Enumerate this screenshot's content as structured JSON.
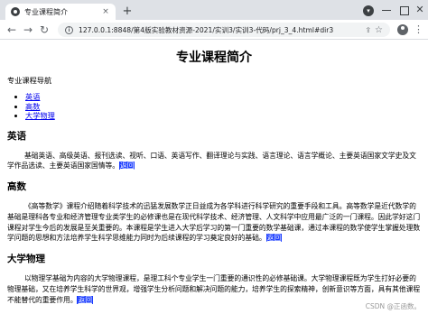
{
  "browser": {
    "tab_title": "专业课程简介",
    "tab_close": "×",
    "new_tab": "+",
    "url": "127.0.0.1:8848/第4版实验教材资源-2021/实训3/实训3-代码/prj_3_4.html#dir3",
    "back": "←",
    "forward": "→",
    "reload": "↻",
    "menu": "⋮"
  },
  "page": {
    "title": "专业课程简介",
    "nav_heading": "专业课程导航",
    "nav_items": [
      "英语",
      "高数",
      "大学物理"
    ],
    "back_link": "返回",
    "sections": [
      {
        "heading": "英语",
        "body": "基础英语、高级英语、报刊选读、视听、口语、英语写作、翻译理论与实践、语言理论、语言学概论、主要英语国家文学史及文学作品选读、主要英语国家国情等。"
      },
      {
        "heading": "高数",
        "body": "《高等数学》课程介绍随着科学技术的迅猛发展数学正日益成为各学科进行科学研究的重要手段和工具。高等数学是近代数学的基础是理科各专业和经济管理专业类学生的必修课也是在现代科学技术、经济管理、人文科学中应用最广泛的一门课程。因此学好这门课程对学生今后的发展是至关重要的。本课程是学生进入大学后学习的第一门重要的数学基础课，通过本课程的数学使学生掌握处理数学问题的思想和方法培养学生科学思维能力同时为后续课程的学习奠定良好的基础。"
      },
      {
        "heading": "大学物理",
        "body": "以物理学基础为内容的大学物理课程，是理工科个专业学生一门重要的通识性的必修基础课。大学物理课程既为学生打好必要的物理基础，又在培养学生科学的世界观，增强学生分析问题和解决问题的能力，培养学生的探索精神，创新意识等方面，具有其他课程不能替代的重要作用。"
      }
    ]
  },
  "watermark": "CSDN @正函数。"
}
